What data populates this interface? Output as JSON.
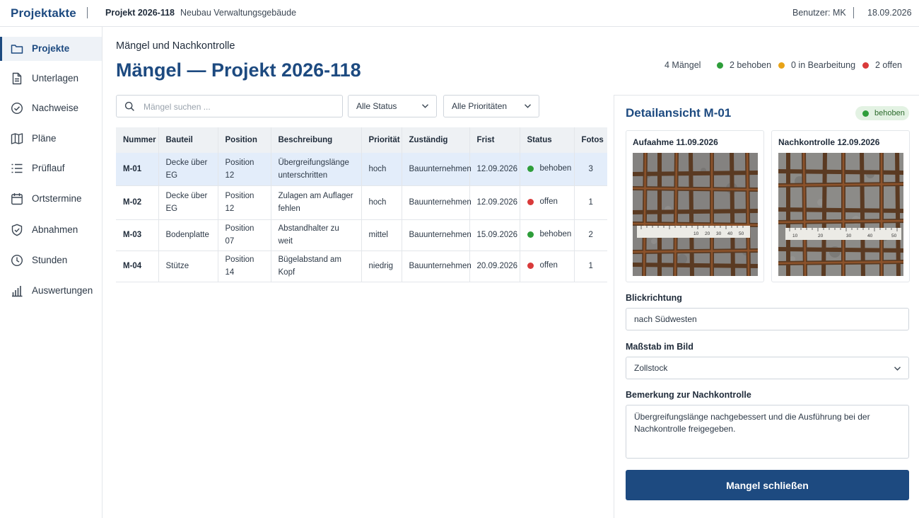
{
  "app": {
    "brand": "Projektakte"
  },
  "topbar": {
    "project": "Projekt 2026-118",
    "description": "Neubau Verwaltungsgebäude",
    "user": "Benutzer: MK",
    "date": "18.09.2026"
  },
  "sidebar": {
    "items": [
      {
        "label": "Projekte",
        "icon": "folder-icon",
        "active": true
      },
      {
        "label": "Unterlagen",
        "icon": "document-icon"
      },
      {
        "label": "Nachweise",
        "icon": "check-circle-icon"
      },
      {
        "label": "Pläne",
        "icon": "map-icon"
      },
      {
        "label": "Prüflauf",
        "icon": "checklist-icon"
      },
      {
        "label": "Ortstermine",
        "icon": "calendar-icon"
      },
      {
        "label": "Abnahmen",
        "icon": "shield-check-icon"
      },
      {
        "label": "Stunden",
        "icon": "clock-icon"
      },
      {
        "label": "Auswertungen",
        "icon": "bar-chart-icon"
      }
    ]
  },
  "main": {
    "breadcrumb": "Mängel und Nachkontrolle",
    "title": "Mängel — Projekt 2026-118",
    "summary": {
      "total": "4 Mängel",
      "fixed": "2 behoben",
      "in_progress": "0 in Bearbeitung",
      "open": "2 offen"
    },
    "search": {
      "placeholder": "Mängel suchen ..."
    },
    "filters": {
      "status": "Alle Status",
      "priority": "Alle Prioritäten"
    },
    "table": {
      "headers": [
        "Nummer",
        "Bauteil",
        "Position",
        "Beschreibung",
        "Priorität",
        "Zuständig",
        "Frist",
        "Status",
        "Fotos"
      ],
      "rows": [
        {
          "nummer": "M-01",
          "bauteil": "Decke über EG",
          "position": "Position 12",
          "beschreibung": "Übergreifungslänge unterschritten",
          "prioritaet": "hoch",
          "zustaendig": "Bauunternehmen",
          "frist": "12.09.2026",
          "status": "behoben",
          "fotos": "3"
        },
        {
          "nummer": "M-02",
          "bauteil": "Decke über EG",
          "position": "Position 12",
          "beschreibung": "Zulagen am Auflager fehlen",
          "prioritaet": "hoch",
          "zustaendig": "Bauunternehmen",
          "frist": "12.09.2026",
          "status": "offen",
          "fotos": "1"
        },
        {
          "nummer": "M-03",
          "bauteil": "Bodenplatte",
          "position": "Position 07",
          "beschreibung": "Abstandhalter zu weit",
          "prioritaet": "mittel",
          "zustaendig": "Bauunternehmen",
          "frist": "15.09.2026",
          "status": "behoben",
          "fotos": "2"
        },
        {
          "nummer": "M-04",
          "bauteil": "Stütze",
          "position": "Position 14",
          "beschreibung": "Bügelabstand am Kopf",
          "prioritaet": "niedrig",
          "zustaendig": "Bauunternehmen",
          "frist": "20.09.2026",
          "status": "offen",
          "fotos": "1"
        }
      ]
    }
  },
  "detail": {
    "title": "Detailansicht M-01",
    "badge": "behoben",
    "photos": [
      {
        "title": "Aufaahme 11.09.2026",
        "ruler": [
          "10",
          "20",
          "30",
          "40",
          "50"
        ]
      },
      {
        "title": "Nachkontrolle 12.09.2026",
        "ruler": [
          "10",
          "20",
          "30",
          "40",
          "50"
        ]
      }
    ],
    "direction": {
      "label": "Blickrichtung",
      "value": "nach Südwesten"
    },
    "scale": {
      "label": "Maßstab im Bild",
      "value": "Zollstock"
    },
    "remark": {
      "label": "Bemerkung zur Nachkontrolle",
      "value": "Übergreifungslänge nachgebessert und die Ausführung bei der Nachkontrolle freigegeben."
    },
    "close_button": "Mangel schließen"
  },
  "colors": {
    "primary": "#1d4a80",
    "green": "#2e9e3a",
    "amber": "#e8a317",
    "red": "#d93a3a",
    "selected_row": "#e3edfa"
  }
}
